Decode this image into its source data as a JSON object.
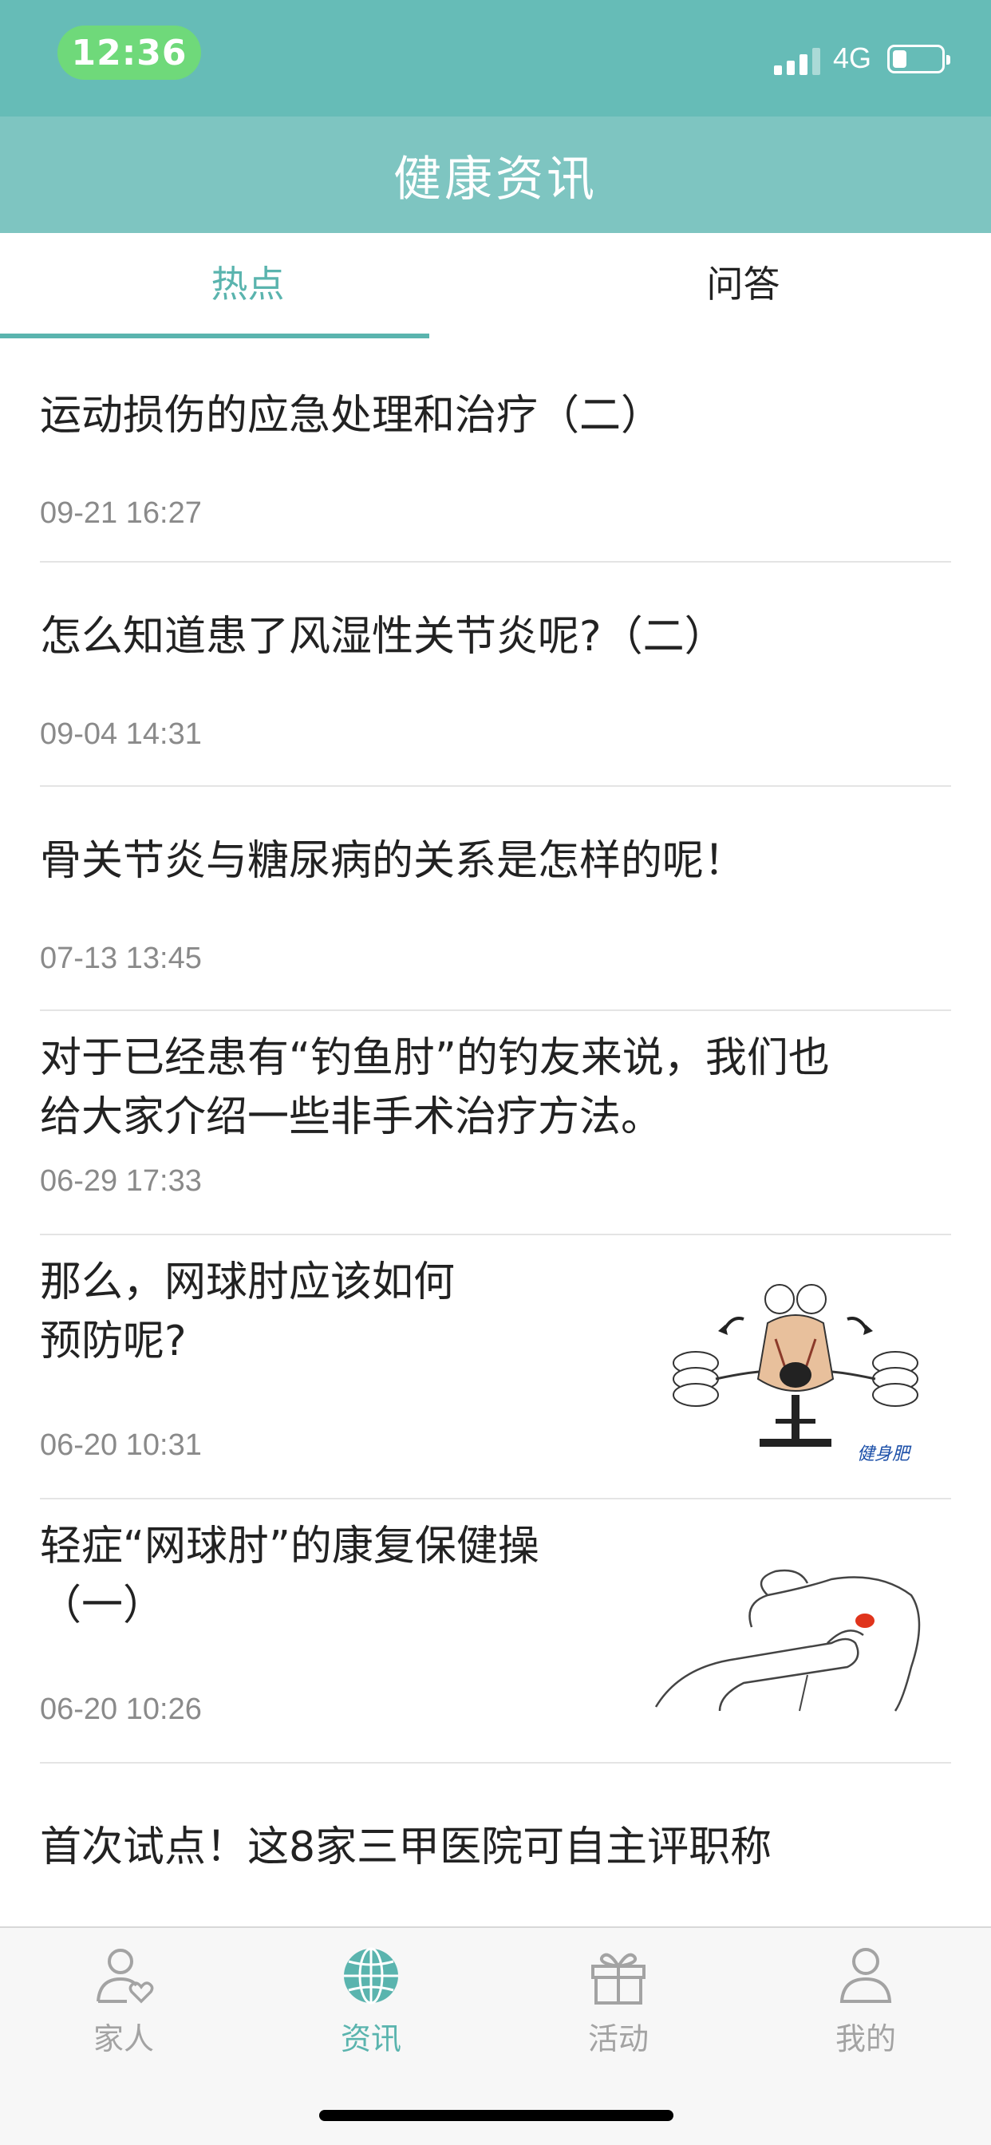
{
  "status_bar": {
    "time": "12:36",
    "network": "4G",
    "battery_level": 0.3
  },
  "header": {
    "title": "健康资讯"
  },
  "tabs": [
    {
      "label": "热点",
      "active": true
    },
    {
      "label": "问答",
      "active": false
    }
  ],
  "articles": [
    {
      "title": "运动损伤的应急处理和治疗（二）",
      "date": "09-21 16:27"
    },
    {
      "title": "怎么知道患了风湿性关节炎呢?（二）",
      "date": "09-04 14:31"
    },
    {
      "title": "骨关节炎与糖尿病的关系是怎样的呢！",
      "date": "07-13 13:45"
    },
    {
      "title_line1": "对于已经患有“钓鱼肘”的钓友来说，我们也",
      "title_line2": "给大家介绍一些非手术治疗方法。",
      "date": "06-29 17:33"
    },
    {
      "title_line1": "那么，网球肘应该如何",
      "title_line2": "预防呢?",
      "date": "06-20 10:31",
      "thumbnail_watermark": "健身肥"
    },
    {
      "title_line1": "轻症“网球肘”的康复保健操",
      "title_line2": "（一）",
      "date": "06-20 10:26"
    },
    {
      "title": "首次试点！这8家三甲医院可自主评职称"
    }
  ],
  "tab_bar": [
    {
      "label": "家人",
      "icon": "family-person-heart-icon",
      "active": false
    },
    {
      "label": "资讯",
      "icon": "globe-icon",
      "active": true
    },
    {
      "label": "活动",
      "icon": "gift-icon",
      "active": false
    },
    {
      "label": "我的",
      "icon": "profile-icon",
      "active": false
    }
  ],
  "colors": {
    "status_bar": "#66bcb7",
    "nav_bar": "#7ec5c1",
    "accent": "#5ab4ae",
    "time_pill": "#6fd97a"
  }
}
